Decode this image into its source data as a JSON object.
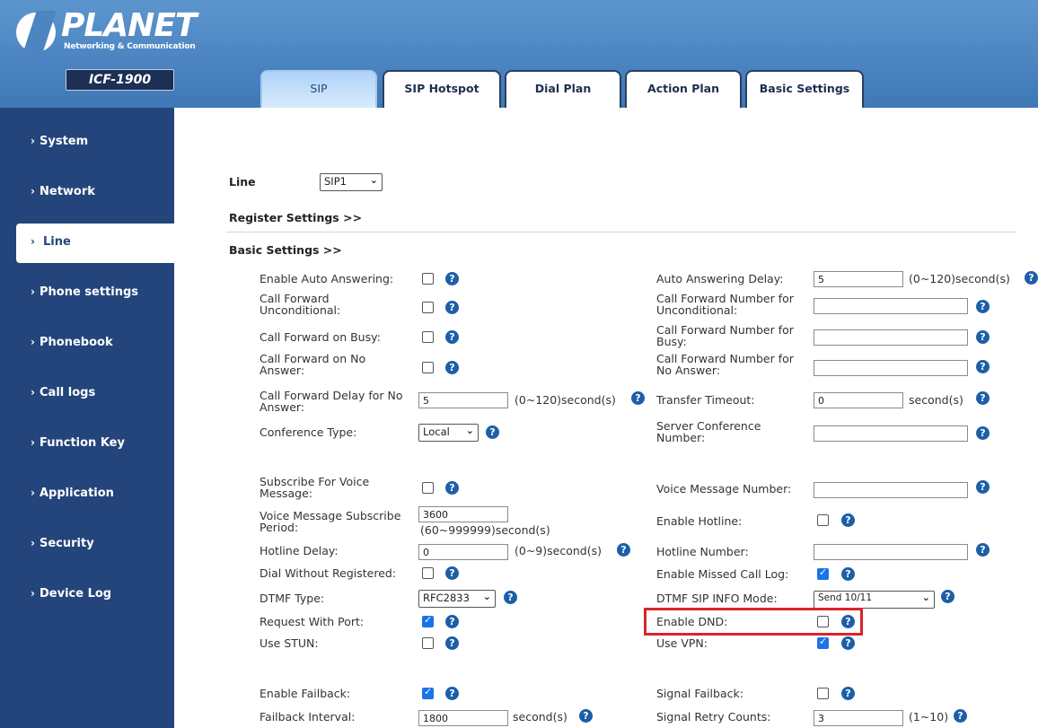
{
  "brand": {
    "name": "PLANET",
    "tagline": "Networking & Communication",
    "model": "ICF-1900"
  },
  "tabs": [
    "SIP",
    "SIP Hotspot",
    "Dial Plan",
    "Action Plan",
    "Basic Settings"
  ],
  "active_tab": "SIP",
  "sidebar": [
    "System",
    "Network",
    "Line",
    "Phone settings",
    "Phonebook",
    "Call logs",
    "Function Key",
    "Application",
    "Security",
    "Device Log"
  ],
  "active_sidebar": "Line",
  "line": {
    "label": "Line",
    "value": "SIP1"
  },
  "sections": {
    "register": "Register Settings >>",
    "basic": "Basic Settings >>"
  },
  "left": {
    "auto_answer": "Enable Auto Answering:",
    "cf_uncond": "Call Forward Unconditional:",
    "cf_busy": "Call Forward on Busy:",
    "cf_noanswer": "Call Forward on No Answer:",
    "cf_delay": "Call Forward Delay for No Answer:",
    "cf_delay_value": "5",
    "cf_delay_unit": "(0~120)second(s)",
    "conf_type": "Conference Type:",
    "conf_type_value": "Local",
    "sub_voice": "Subscribe For Voice Message:",
    "vm_period": "Voice Message Subscribe Period:",
    "vm_period_value": "3600",
    "vm_period_unit": "(60~999999)second(s)",
    "hotline_delay": "Hotline Delay:",
    "hotline_delay_value": "0",
    "hotline_delay_unit": "(0~9)second(s)",
    "dial_without_reg": "Dial Without Registered:",
    "dtmf_type": "DTMF Type:",
    "dtmf_type_value": "RFC2833",
    "req_port": "Request With Port:",
    "use_stun": "Use STUN:",
    "failback": "Enable Failback:",
    "failback_interval": "Failback Interval:",
    "failback_interval_value": "1800",
    "failback_interval_unit": "second(s)"
  },
  "right": {
    "auto_answer_delay": "Auto Answering Delay:",
    "auto_answer_delay_value": "5",
    "auto_answer_delay_unit": "(0~120)second(s)",
    "cf_num_uncond": "Call Forward Number for Unconditional:",
    "cf_num_busy": "Call Forward Number for Busy:",
    "cf_num_noanswer": "Call Forward Number for No Answer:",
    "transfer_timeout": "Transfer Timeout:",
    "transfer_timeout_value": "0",
    "transfer_timeout_unit": "second(s)",
    "server_conf": "Server Conference Number:",
    "vm_number": "Voice Message Number:",
    "hotline": "Enable Hotline:",
    "hotline_number": "Hotline Number:",
    "missed_call_log": "Enable Missed Call Log:",
    "dtmf_sip_info": "DTMF SIP INFO Mode:",
    "dtmf_sip_info_value": "Send 10/11",
    "dnd": "Enable DND:",
    "vpn": "Use VPN:",
    "signal_failback": "Signal Failback:",
    "retry_counts": "Signal Retry Counts:",
    "retry_counts_value": "3",
    "retry_counts_unit": "(1~10)"
  },
  "help_glyph": "?",
  "colors": {
    "header": "#4c85c1",
    "sidebar": "#24457b",
    "help": "#1c5fa8",
    "checkbox_on": "#1a73e8",
    "highlight": "#d9252a"
  }
}
